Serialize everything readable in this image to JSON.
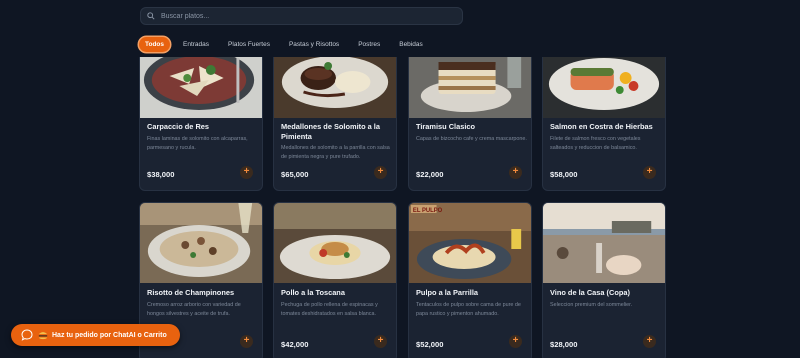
{
  "search": {
    "placeholder": "Buscar platos..."
  },
  "tabs": [
    {
      "label": "Todos",
      "active": true
    },
    {
      "label": "Entradas",
      "active": false
    },
    {
      "label": "Platos Fuertes",
      "active": false
    },
    {
      "label": "Pastas y Risottos",
      "active": false
    },
    {
      "label": "Postres",
      "active": false
    },
    {
      "label": "Bebidas",
      "active": false
    }
  ],
  "dishes": [
    {
      "name": "Carpaccio de Res",
      "desc": "Finas laminas de solomito con alcaparras, parmesano y rucula.",
      "price": "$38,000",
      "add_label": "+"
    },
    {
      "name": "Medallones de Solomito a la Pimienta",
      "desc": "Medallones de solomito a la parrilla con salsa de pimienta negra y pure trufado.",
      "price": "$65,000",
      "add_label": "+"
    },
    {
      "name": "Tiramisu Clasico",
      "desc": "Capas de bizcocho cafe y crema mascarpone.",
      "price": "$22,000",
      "add_label": "+"
    },
    {
      "name": "Salmon en Costra de Hierbas",
      "desc": "Filete de salmon fresco con vegetales salteados y reduccion de balsamico.",
      "price": "$58,000",
      "add_label": "+"
    },
    {
      "name": "Risotto de Champinones",
      "desc": "Cremoso arroz arborio con variedad de hongos silvestres y aceite de trufa.",
      "price": "",
      "add_label": "+"
    },
    {
      "name": "Pollo a la Toscana",
      "desc": "Pechuga de pollo rellena de espinacas y tomates deshidratados en salsa blanca.",
      "price": "$42,000",
      "add_label": "+"
    },
    {
      "name": "Pulpo a la Parrilla",
      "desc": "Tentaculos de pulpo sobre cama de pure de papa rustico y pimenton ahumado.",
      "price": "$52,000",
      "add_label": "+"
    },
    {
      "name": "Vino de la Casa (Copa)",
      "desc": "Seleccion premium del sommelier.",
      "price": "$28,000",
      "add_label": "+"
    }
  ],
  "image_labels": {
    "pulpo_sign": "EL PULPO"
  },
  "chat": {
    "label": "Haz tu pedido por ChatAI o Carrito"
  },
  "colors": {
    "accent": "#e8620f",
    "background": "#0f1623",
    "card": "#1b2332"
  }
}
